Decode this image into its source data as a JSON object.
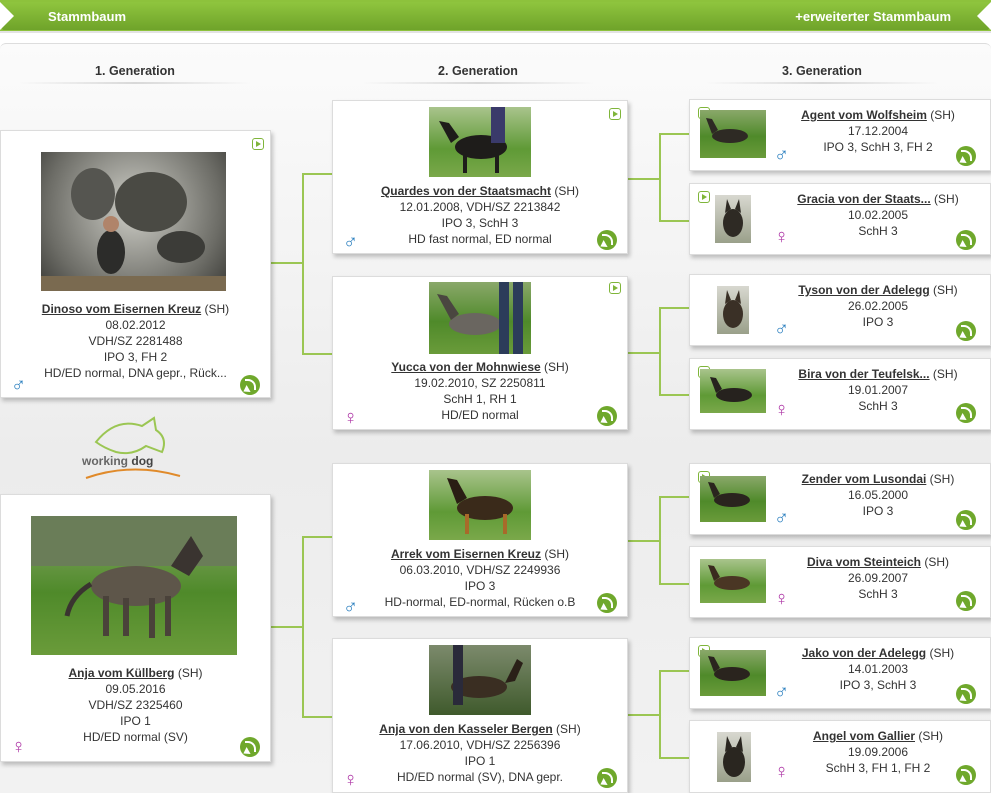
{
  "header": {
    "title": "Stammbaum",
    "extended_link": "+erweiterter Stammbaum"
  },
  "generations": [
    "1. Generation",
    "2. Generation",
    "3. Generation"
  ],
  "logo": {
    "word1": "working",
    "word2": "dog"
  },
  "dogs": {
    "g1_sire": {
      "name": "Dinoso vom Eisernen Kreuz",
      "tag": "(SH)",
      "lines": [
        "08.02.2012",
        "VDH/SZ 2281488",
        "IPO 3, FH 2",
        "HD/ED normal, DNA gepr., Rück..."
      ],
      "sex": "♂"
    },
    "g1_dam": {
      "name": "Anja vom Küllberg",
      "tag": "(SH)",
      "lines": [
        "09.05.2016",
        "VDH/SZ 2325460",
        "IPO 1",
        "HD/ED normal (SV)"
      ],
      "sex": "♀"
    },
    "g2_a": {
      "name": "Quardes von der Staatsmacht",
      "tag": "(SH)",
      "lines": [
        "12.01.2008, VDH/SZ 2213842",
        "IPO 3, SchH 3",
        "HD fast normal, ED normal"
      ],
      "sex": "♂"
    },
    "g2_b": {
      "name": "Yucca von der Mohnwiese",
      "tag": "(SH)",
      "lines": [
        "19.02.2010, SZ 2250811",
        "SchH 1, RH 1",
        "HD/ED normal"
      ],
      "sex": "♀"
    },
    "g2_c": {
      "name": "Arrek vom Eisernen Kreuz",
      "tag": "(SH)",
      "lines": [
        "06.03.2010, VDH/SZ 2249936",
        "IPO 3",
        "HD-normal, ED-normal, Rücken o.B"
      ],
      "sex": "♂"
    },
    "g2_d": {
      "name": "Anja von den Kasseler Bergen",
      "tag": "(SH)",
      "lines": [
        "17.06.2010, VDH/SZ 2256396",
        "IPO 1",
        "HD/ED normal (SV), DNA gepr."
      ],
      "sex": "♀"
    },
    "g3_1": {
      "name": "Agent vom Wolfsheim",
      "tag": "(SH)",
      "lines": [
        "17.12.2004",
        "IPO 3, SchH 3, FH 2"
      ],
      "sex": "♂"
    },
    "g3_2": {
      "name": "Gracia von der Staats...",
      "tag": "(SH)",
      "lines": [
        "10.02.2005",
        "SchH 3"
      ],
      "sex": "♀"
    },
    "g3_3": {
      "name": "Tyson von der Adelegg",
      "tag": "(SH)",
      "lines": [
        "26.02.2005",
        "IPO 3"
      ],
      "sex": "♂"
    },
    "g3_4": {
      "name": "Bira von der Teufelsk...",
      "tag": "(SH)",
      "lines": [
        "19.01.2007",
        "SchH 3"
      ],
      "sex": "♀"
    },
    "g3_5": {
      "name": "Zender vom Lusondai",
      "tag": "(SH)",
      "lines": [
        "16.05.2000",
        "IPO 3"
      ],
      "sex": "♂"
    },
    "g3_6": {
      "name": "Diva vom Steinteich",
      "tag": "(SH)",
      "lines": [
        "26.09.2007",
        "SchH 3"
      ],
      "sex": "♀"
    },
    "g3_7": {
      "name": "Jako von der Adelegg",
      "tag": "(SH)",
      "lines": [
        "14.01.2003",
        "IPO 3, SchH 3"
      ],
      "sex": "♂"
    },
    "g3_8": {
      "name": "Angel vom Gallier",
      "tag": "(SH)",
      "lines": [
        "19.09.2006",
        "SchH 3, FH 1, FH 2"
      ],
      "sex": "♀"
    }
  }
}
